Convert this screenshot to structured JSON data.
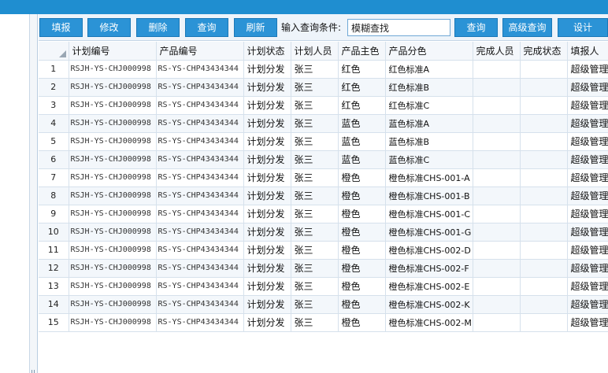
{
  "toolbar": {
    "buttons": [
      "填报",
      "修改",
      "删除",
      "查询",
      "刷新"
    ],
    "query_label": "输入查询条件:",
    "query_input_value": "模糊查找",
    "right_buttons": [
      "查询",
      "高级查询",
      "设计"
    ]
  },
  "grid": {
    "headers": [
      "计划编号",
      "产品编号",
      "计划状态",
      "计划人员",
      "产品主色",
      "产品分色",
      "完成人员",
      "完成状态",
      "填报人"
    ],
    "rows": [
      {
        "no": "1",
        "plan": "RSJH-YS-CHJ000998",
        "product": "RS-YS-CHP43434344",
        "status": "计划分发",
        "person": "张三",
        "main_color": "红色",
        "sub_color": "红色标准A",
        "done_person": "",
        "done_status": "",
        "reporter": "超级管理员"
      },
      {
        "no": "2",
        "plan": "RSJH-YS-CHJ000998",
        "product": "RS-YS-CHP43434344",
        "status": "计划分发",
        "person": "张三",
        "main_color": "红色",
        "sub_color": "红色标准B",
        "done_person": "",
        "done_status": "",
        "reporter": "超级管理员"
      },
      {
        "no": "3",
        "plan": "RSJH-YS-CHJ000998",
        "product": "RS-YS-CHP43434344",
        "status": "计划分发",
        "person": "张三",
        "main_color": "红色",
        "sub_color": "红色标准C",
        "done_person": "",
        "done_status": "",
        "reporter": "超级管理员"
      },
      {
        "no": "4",
        "plan": "RSJH-YS-CHJ000998",
        "product": "RS-YS-CHP43434344",
        "status": "计划分发",
        "person": "张三",
        "main_color": "蓝色",
        "sub_color": "蓝色标准A",
        "done_person": "",
        "done_status": "",
        "reporter": "超级管理员"
      },
      {
        "no": "5",
        "plan": "RSJH-YS-CHJ000998",
        "product": "RS-YS-CHP43434344",
        "status": "计划分发",
        "person": "张三",
        "main_color": "蓝色",
        "sub_color": "蓝色标准B",
        "done_person": "",
        "done_status": "",
        "reporter": "超级管理员"
      },
      {
        "no": "6",
        "plan": "RSJH-YS-CHJ000998",
        "product": "RS-YS-CHP43434344",
        "status": "计划分发",
        "person": "张三",
        "main_color": "蓝色",
        "sub_color": "蓝色标准C",
        "done_person": "",
        "done_status": "",
        "reporter": "超级管理员"
      },
      {
        "no": "7",
        "plan": "RSJH-YS-CHJ000998",
        "product": "RS-YS-CHP43434344",
        "status": "计划分发",
        "person": "张三",
        "main_color": "橙色",
        "sub_color": "橙色标准CHS-001-A",
        "done_person": "",
        "done_status": "",
        "reporter": "超级管理员"
      },
      {
        "no": "8",
        "plan": "RSJH-YS-CHJ000998",
        "product": "RS-YS-CHP43434344",
        "status": "计划分发",
        "person": "张三",
        "main_color": "橙色",
        "sub_color": "橙色标准CHS-001-B",
        "done_person": "",
        "done_status": "",
        "reporter": "超级管理员"
      },
      {
        "no": "9",
        "plan": "RSJH-YS-CHJ000998",
        "product": "RS-YS-CHP43434344",
        "status": "计划分发",
        "person": "张三",
        "main_color": "橙色",
        "sub_color": "橙色标准CHS-001-C",
        "done_person": "",
        "done_status": "",
        "reporter": "超级管理员"
      },
      {
        "no": "10",
        "plan": "RSJH-YS-CHJ000998",
        "product": "RS-YS-CHP43434344",
        "status": "计划分发",
        "person": "张三",
        "main_color": "橙色",
        "sub_color": "橙色标准CHS-001-G",
        "done_person": "",
        "done_status": "",
        "reporter": "超级管理员"
      },
      {
        "no": "11",
        "plan": "RSJH-YS-CHJ000998",
        "product": "RS-YS-CHP43434344",
        "status": "计划分发",
        "person": "张三",
        "main_color": "橙色",
        "sub_color": "橙色标准CHS-002-D",
        "done_person": "",
        "done_status": "",
        "reporter": "超级管理员"
      },
      {
        "no": "12",
        "plan": "RSJH-YS-CHJ000998",
        "product": "RS-YS-CHP43434344",
        "status": "计划分发",
        "person": "张三",
        "main_color": "橙色",
        "sub_color": "橙色标准CHS-002-F",
        "done_person": "",
        "done_status": "",
        "reporter": "超级管理员"
      },
      {
        "no": "13",
        "plan": "RSJH-YS-CHJ000998",
        "product": "RS-YS-CHP43434344",
        "status": "计划分发",
        "person": "张三",
        "main_color": "橙色",
        "sub_color": "橙色标准CHS-002-E",
        "done_person": "",
        "done_status": "",
        "reporter": "超级管理员"
      },
      {
        "no": "14",
        "plan": "RSJH-YS-CHJ000998",
        "product": "RS-YS-CHP43434344",
        "status": "计划分发",
        "person": "张三",
        "main_color": "橙色",
        "sub_color": "橙色标准CHS-002-K",
        "done_person": "",
        "done_status": "",
        "reporter": "超级管理员"
      },
      {
        "no": "15",
        "plan": "RSJH-YS-CHJ000998",
        "product": "RS-YS-CHP43434344",
        "status": "计划分发",
        "person": "张三",
        "main_color": "橙色",
        "sub_color": "橙色标准CHS-002-M",
        "done_person": "",
        "done_status": "",
        "reporter": "超级管理员"
      }
    ]
  },
  "splitter_grip": "||",
  "colors": {
    "accent": "#2b93d6",
    "topbar": "#1f8ed0"
  }
}
